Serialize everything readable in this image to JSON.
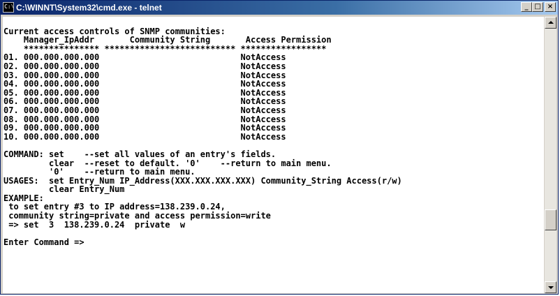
{
  "window": {
    "title": "C:\\WINNT\\System32\\cmd.exe - telnet",
    "icon_label": "C:\\",
    "minimize_label": "_",
    "maximize_label": "□",
    "close_label": "×"
  },
  "console": {
    "lines": [
      "",
      "Current access controls of SNMP communities:",
      "    Manager_IpAddr       Community String       Access Permission",
      "    *************** ************************** *****************",
      "01. 000.000.000.000                            NotAccess",
      "02. 000.000.000.000                            NotAccess",
      "03. 000.000.000.000                            NotAccess",
      "04. 000.000.000.000                            NotAccess",
      "05. 000.000.000.000                            NotAccess",
      "06. 000.000.000.000                            NotAccess",
      "07. 000.000.000.000                            NotAccess",
      "08. 000.000.000.000                            NotAccess",
      "09. 000.000.000.000                            NotAccess",
      "10. 000.000.000.000                            NotAccess",
      "",
      "COMMAND: set    --set all values of an entry's fields.",
      "         clear  --reset to default. '0'    --return to main menu.",
      "         '0'    --return to main menu.",
      "USAGES:  set Entry_Num IP_Address(XXX.XXX.XXX.XXX) Community_String Access(r/w)",
      "         clear Entry_Num",
      "EXAMPLE:",
      " to set entry #3 to IP address=138.239.0.24,",
      " community string=private and access permission=write",
      " => set  3  138.239.0.24  private  w",
      "",
      "Enter Command =>"
    ]
  },
  "scrollbar": {
    "thumb_position": 0.78
  },
  "colors": {
    "titlebar_start": "#0a246a",
    "titlebar_end": "#a6caf0",
    "console_bg": "#ffffff",
    "console_fg": "#000000"
  }
}
